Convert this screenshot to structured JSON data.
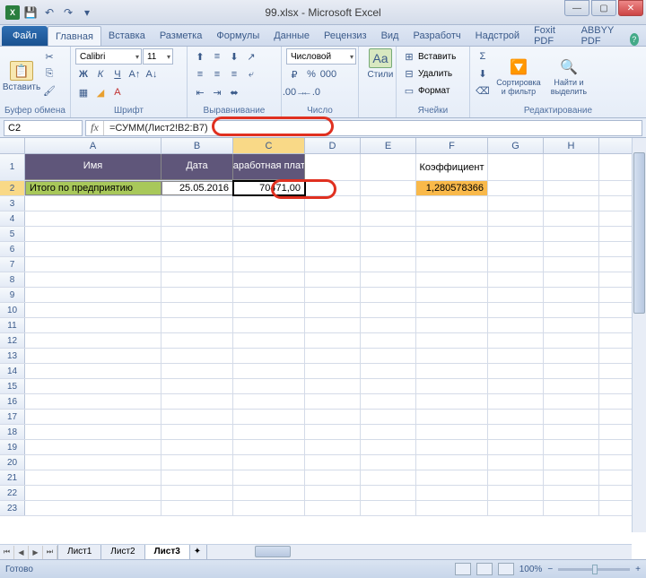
{
  "title": "99.xlsx - Microsoft Excel",
  "qat": {
    "save": "💾",
    "undo": "↶",
    "redo": "↷"
  },
  "tabs": {
    "file": "Файл",
    "items": [
      "Главная",
      "Вставка",
      "Разметка",
      "Формулы",
      "Данные",
      "Рецензиз",
      "Вид",
      "Разработч",
      "Надстрой",
      "Foxit PDF",
      "ABBYY PDF"
    ],
    "active": 0
  },
  "ribbon": {
    "clipboard": {
      "paste": "Вставить",
      "label": "Буфер обмена"
    },
    "font": {
      "name": "Calibri",
      "size": "11",
      "label": "Шрифт"
    },
    "align": {
      "label": "Выравнивание"
    },
    "number": {
      "format": "Числовой",
      "label": "Число"
    },
    "styles": {
      "btn": "Стили",
      "label": ""
    },
    "cells": {
      "insert": "Вставить",
      "delete": "Удалить",
      "format": "Формат",
      "label": "Ячейки"
    },
    "editing": {
      "sort": "Сортировка и фильтр",
      "find": "Найти и выделить",
      "label": "Редактирование"
    }
  },
  "namebox": "C2",
  "formula": "=СУММ(Лист2!B2:B7)",
  "columns": [
    "A",
    "B",
    "C",
    "D",
    "E",
    "F",
    "G",
    "H"
  ],
  "rows": [
    1,
    2,
    3,
    4,
    5,
    6,
    7,
    8,
    9,
    10,
    11,
    12,
    13,
    14,
    15,
    16,
    17,
    18,
    19,
    20,
    21,
    22,
    23
  ],
  "headers": {
    "A": "Имя",
    "B": "Дата",
    "C": "Заработная плата",
    "F": "Коэффициент"
  },
  "data_row": {
    "A": "Итого по предприятию",
    "B": "25.05.2016",
    "C": "70471,00",
    "F": "1,280578366"
  },
  "sheets": {
    "tabs": [
      "Лист1",
      "Лист2",
      "Лист3"
    ],
    "active": 2
  },
  "status": {
    "ready": "Готово",
    "zoom": "100%"
  }
}
